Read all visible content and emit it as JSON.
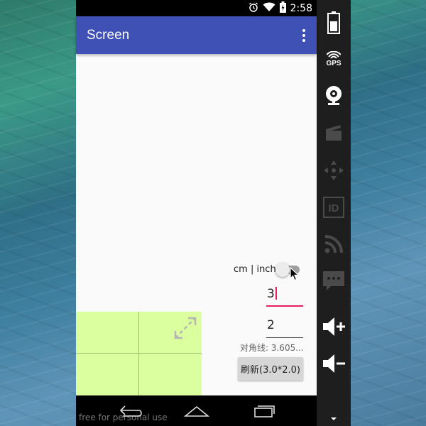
{
  "status_bar": {
    "time": "2:58",
    "alarm_icon": "alarm-icon",
    "wifi_icon": "wifi-icon",
    "battery_icon": "battery-charging-icon"
  },
  "app_bar": {
    "title": "Screen",
    "menu_icon": "overflow-menu-icon",
    "color": "#3f51b5"
  },
  "form": {
    "unit_label": "cm | inch",
    "unit_switch_state": "off",
    "width_value": "3",
    "height_value": "2",
    "diagonal_text": "对角线: 3.605...",
    "refresh_label": "刷新(3.0*2.0)",
    "accent_color": "#e91e63"
  },
  "preview": {
    "color": "#dbff9e",
    "icon": "expand-diagonal-icon"
  },
  "nav_bar": {
    "back_icon": "back-icon",
    "home_icon": "home-icon",
    "recents_icon": "recents-icon"
  },
  "watermark": "free for personal use",
  "emulator_toolbar": {
    "tools": [
      "battery-icon",
      "gps-icon",
      "webcam-icon",
      "screencast-icon",
      "dpad-icon",
      "device-id-icon",
      "rss-network-icon",
      "sms-icon",
      "volume-up-icon",
      "volume-down-icon"
    ],
    "gps_label": "GPS",
    "id_label": "ID"
  }
}
